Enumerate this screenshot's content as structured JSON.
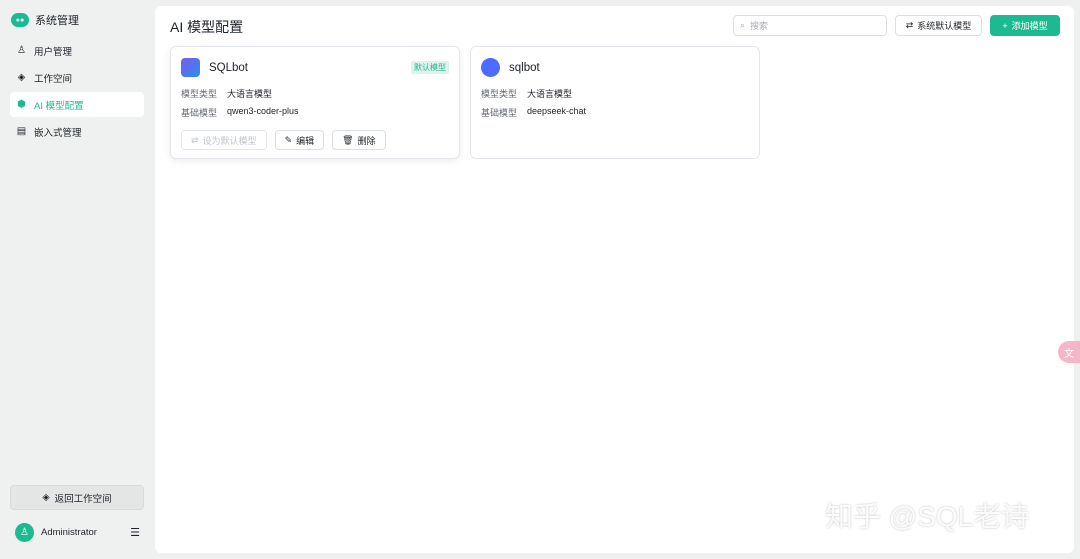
{
  "sidebar": {
    "brand": "系统管理",
    "items": [
      {
        "label": "用户管理"
      },
      {
        "label": "工作空间"
      },
      {
        "label": "AI 模型配置"
      },
      {
        "label": "嵌入式管理"
      }
    ],
    "back": "返回工作空间",
    "user": "Administrator"
  },
  "header": {
    "title": "AI 模型配置",
    "search_placeholder": "搜索",
    "default_btn": "系统默认模型",
    "add_btn": "添加模型"
  },
  "cards": [
    {
      "name": "SQLbot",
      "badge": "默认模型",
      "type_label": "模型类型",
      "type": "大语言模型",
      "base_label": "基础模型",
      "base": "qwen3-coder-plus",
      "set_default": "设为默认模型",
      "edit": "编辑",
      "delete": "删除"
    },
    {
      "name": "sqlbot",
      "type_label": "模型类型",
      "type": "大语言模型",
      "base_label": "基础模型",
      "base": "deepseek-chat"
    }
  ],
  "watermark": "知乎 @SQL老诗",
  "accent": "#1cba90"
}
